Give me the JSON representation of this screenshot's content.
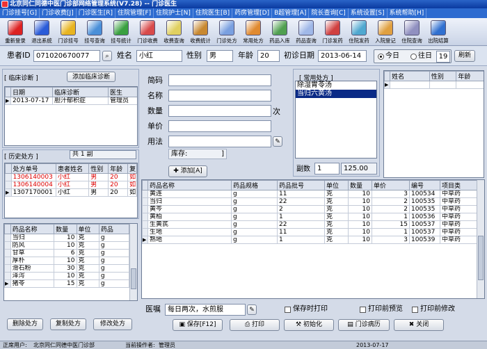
{
  "window": {
    "title": "北京同仁同德中医门诊部网络管理系统(V7.28) -- 门诊医生"
  },
  "menu": [
    "门诊挂号[G]",
    "门诊收费[J]",
    "门诊医生[R]",
    "住院管理[F]",
    "住院护士[N]",
    "住院医生[B]",
    "药房管理[D]",
    "B超管理[A]",
    "院长查询[C]",
    "系统设置[S]",
    "系统帮助[H]"
  ],
  "toolbar": [
    {
      "label": "重新登录",
      "color": "#d22"
    },
    {
      "label": "退出系统",
      "color": "#2a5bd8"
    },
    {
      "label": "门诊挂号",
      "color": "#e8b420"
    },
    {
      "label": "挂号查询",
      "color": "#4a8fd8"
    },
    {
      "label": "挂号统计",
      "color": "#3aa040"
    },
    {
      "label": "门诊收费",
      "color": "#d84a4a"
    },
    {
      "label": "收费查询",
      "color": "#e0d060"
    },
    {
      "label": "收费统计",
      "color": "#c88830"
    },
    {
      "label": "门诊处方",
      "color": "#7aa0e0"
    },
    {
      "label": "常用处方",
      "color": "#e08a30"
    },
    {
      "label": "药品入库",
      "color": "#50a050"
    },
    {
      "label": "药品查询",
      "color": "#a0b8e8"
    },
    {
      "label": "门诊发药",
      "color": "#d04040"
    },
    {
      "label": "住院发药",
      "color": "#50a8d0"
    },
    {
      "label": "入院登记",
      "color": "#e0a040"
    },
    {
      "label": "住院查询",
      "color": "#9090c0"
    },
    {
      "label": "出院结算",
      "color": "#3070d0"
    }
  ],
  "patient": {
    "id_label": "患者ID",
    "id_value": "071020670077",
    "name_label": "姓名",
    "name_value": "小红",
    "gender_label": "性别",
    "gender_value": "男",
    "age_label": "年龄",
    "age_value": "20",
    "date_label": "初诊日期",
    "date_value": "2013-06-14",
    "today_label": "今日",
    "past_label": "往日",
    "count_value": "19",
    "refresh_label": "刷新"
  },
  "diagnosis": {
    "section_label": "[ 临床诊断 ]",
    "add_label": "添加临床诊断",
    "columns": [
      "日期",
      "临床诊断",
      "医生"
    ],
    "rows": [
      [
        "2013-07-17",
        "胆汁郁积症",
        "管理员"
      ]
    ]
  },
  "history": {
    "section_label": "[ 历史处方 ]",
    "total_label": "共 1 副",
    "columns": [
      "处方单号",
      "患者姓名",
      "性别",
      "年龄",
      "复"
    ],
    "rows": [
      [
        "1306140003",
        "小红",
        "男",
        "20",
        "如"
      ],
      [
        "1306140004",
        "小红",
        "男",
        "20",
        "如"
      ],
      [
        "1307170001",
        "小红",
        "男",
        "20",
        "如"
      ]
    ]
  },
  "history_detail": {
    "columns": [
      "药品名称",
      "数量",
      "单位",
      "药品"
    ],
    "rows": [
      [
        "当归",
        "10",
        "克",
        "g"
      ],
      [
        "防风",
        "10",
        "克",
        "g"
      ],
      [
        "甘草",
        "6",
        "克",
        "g"
      ],
      [
        "厚朴",
        "10",
        "克",
        "g"
      ],
      [
        "滑石粉",
        "30",
        "克",
        "g"
      ],
      [
        "泽泻",
        "10",
        "克",
        "g"
      ],
      [
        "猪苓",
        "15",
        "克",
        "g"
      ]
    ]
  },
  "left_buttons": {
    "delete": "删除处方",
    "copy": "复制处方",
    "modify": "修改处方"
  },
  "form": {
    "code_label": "简码",
    "name_label": "名称",
    "qty_label": "数量",
    "qty_unit": "次",
    "price_label": "单价",
    "usage_label": "用法",
    "stock_label": "库存:",
    "stock_end": "]",
    "add_label": "添加[A]"
  },
  "common": {
    "section_label": "[ 常用处方 ]",
    "items": [
      "除湿胃苓汤",
      "当归六黄汤"
    ],
    "doses_label": "副数",
    "doses_value": "1",
    "amount_value": "125.00"
  },
  "right_grid": {
    "columns": [
      "姓名",
      "性别",
      "年龄"
    ]
  },
  "rx": {
    "columns": [
      "药品名称",
      "药品规格",
      "药品批号",
      "单位",
      "数量",
      "单价",
      "编号",
      "项目类"
    ],
    "rows": [
      [
        "黄连",
        "g",
        "11",
        "克",
        "10",
        "3",
        "100534",
        "中草药"
      ],
      [
        "当归",
        "g",
        "22",
        "克",
        "10",
        "2",
        "100535",
        "中草药"
      ],
      [
        "黄芩",
        "g",
        "2",
        "克",
        "10",
        "2",
        "100535",
        "中草药"
      ],
      [
        "黄柏",
        "g",
        "1",
        "克",
        "10",
        "1",
        "100536",
        "中草药"
      ],
      [
        "生黄芪",
        "g",
        "22",
        "克",
        "10",
        "15",
        "100537",
        "中草药"
      ],
      [
        "生地",
        "g",
        "11",
        "克",
        "10",
        "1",
        "100537",
        "中草药"
      ],
      [
        "熟地",
        "g",
        "1",
        "克",
        "10",
        "3",
        "100539",
        "中草药"
      ]
    ]
  },
  "instructions": {
    "label": "医嘱",
    "value": "每日两次，水煎服",
    "print_on_save": "保存时打印",
    "print_preview": "打印前预览",
    "modify_before_print": "打印前修改"
  },
  "actions": {
    "save": "保存[F12]",
    "print": "打印",
    "init": "初始化",
    "query": "门诊病历",
    "close": "关闭"
  },
  "status": {
    "user_label": "正席用户:",
    "user_value": "北京同仁同德中医门诊部",
    "operator_label": "当前操作者:",
    "operator_value": "管理员",
    "date": "2013-07-17"
  }
}
